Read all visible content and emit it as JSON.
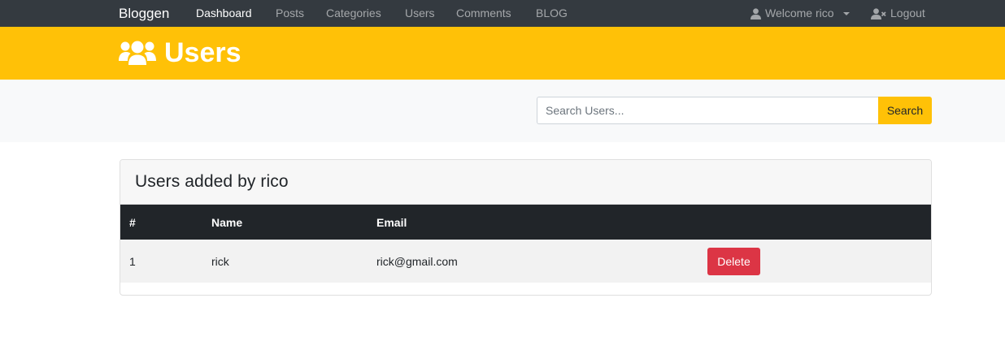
{
  "navbar": {
    "brand": "Bloggen",
    "links": [
      "Dashboard",
      "Posts",
      "Categories",
      "Users",
      "Comments",
      "BLOG"
    ],
    "active": "Dashboard",
    "user_menu": "Welcome rico",
    "logout": "Logout",
    "bg_color": "#343a40"
  },
  "header": {
    "title": "Users",
    "icon": "users-icon",
    "bg_color": "#ffc107"
  },
  "search": {
    "placeholder": "Search Users...",
    "button_label": "Search"
  },
  "card": {
    "title": "Users added by rico",
    "columns": [
      "#",
      "Name",
      "Email",
      ""
    ],
    "rows": [
      {
        "id": "1",
        "name": "rick",
        "email": "rick@gmail.com",
        "action": "Delete"
      }
    ]
  },
  "colors": {
    "accent": "#ffc107",
    "danger": "#dc3545",
    "dark": "#212529"
  }
}
